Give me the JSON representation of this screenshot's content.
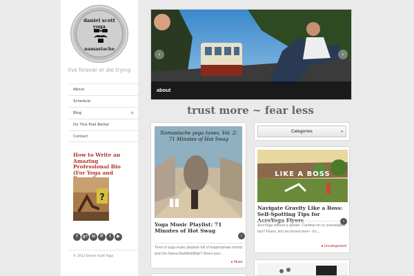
{
  "brand": {
    "logo_top": "daniel scott yoga",
    "logo_bottom": "namastache",
    "tagline": "live forever or die trying"
  },
  "nav": {
    "items": [
      {
        "label": "About"
      },
      {
        "label": "Schedule"
      },
      {
        "label": "Blog",
        "expand": "+"
      },
      {
        "label": "Do This Feel Better"
      },
      {
        "label": "Contact"
      }
    ]
  },
  "sidebar_post": {
    "title": "How to Write an Amazing Professional Bio (For Yoga and Beyond)"
  },
  "social": {
    "icons": [
      "facebook-icon",
      "google-plus-icon",
      "linkedin-icon",
      "pinterest-icon",
      "twitter-icon",
      "youtube-icon"
    ],
    "glyphs": [
      "f",
      "g+",
      "in",
      "P",
      "t",
      "▶"
    ]
  },
  "footer": {
    "copyright": "© 2012 Daniel Scott Yoga"
  },
  "slider": {
    "caption": "about",
    "prev": "‹",
    "next": "›"
  },
  "headline": "trust more ~ fear less",
  "categories_select": {
    "label": "Categories",
    "caret": "▾"
  },
  "posts": [
    {
      "image_title": "Namastache yoga tunes, Vol. 2: 71 Minutes of Hot Swag",
      "title": "Yoga Music Playlist: 71 Minutes of Hot Swag",
      "excerpt": "Tired of yoga music playlists full of inappropriate oonntz and Om Nama BlahBlahBlah? Direct your...",
      "category": "Music",
      "more": "›"
    },
    {
      "image_title": "LIKE A BOSS",
      "title": "Navigate Gravity Like a Boss: Self-Spotting Tips for AcroYoga Flyers",
      "excerpt": "AcroYoga without a spotter. Cardinal sin or unavoidable fact? Flyers, let's be honest here-- it's...",
      "category": "Uncategorized",
      "more": "›"
    }
  ],
  "colors": {
    "accent": "#b2312c",
    "background": "#eaeaea",
    "headline": "#666666"
  }
}
